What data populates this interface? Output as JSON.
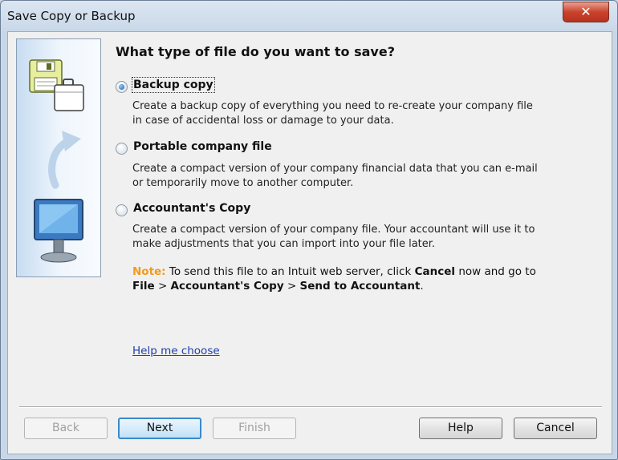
{
  "window": {
    "title": "Save Copy or Backup",
    "close_label": "✕"
  },
  "main": {
    "heading": "What type of file do you want to save?",
    "options": [
      {
        "label": "Backup copy",
        "selected": true,
        "desc1": "Create a backup copy of everything you need to re-create your company file",
        "desc2": "in case of accidental loss or damage to your data."
      },
      {
        "label": "Portable company file",
        "selected": false,
        "desc1": "Create a compact version of your company financial data that you can e-mail",
        "desc2": "or temporarily move to another computer."
      },
      {
        "label": "Accountant's Copy",
        "selected": false,
        "desc1": "Create a compact version of your company file. Your accountant will use it to",
        "desc2": "make adjustments that you can import into your file later."
      }
    ],
    "note": {
      "label": "Note:",
      "t1": "To send this file to an Intuit web server, click",
      "cancel": "Cancel",
      "t2": "now and go to",
      "file": "File",
      "gt1": ">",
      "acct": "Accountant's Copy",
      "gt2": ">",
      "send": "Send to Accountant",
      "period": "."
    },
    "help_link": "Help me choose"
  },
  "buttons": {
    "back": "Back",
    "next": "Next",
    "finish": "Finish",
    "help": "Help",
    "cancel": "Cancel"
  },
  "colors": {
    "note_accent": "#f29a1d",
    "link": "#1f3ea8",
    "default_button_border": "#3b89c9"
  },
  "icons": [
    "floppy-disk-icon",
    "briefcase-icon",
    "curved-arrow-icon",
    "computer-monitor-icon"
  ]
}
